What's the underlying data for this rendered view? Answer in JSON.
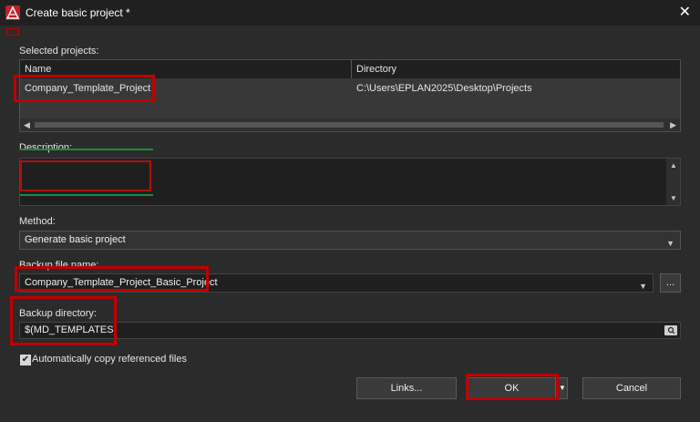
{
  "window": {
    "title": "Create basic project *",
    "close_glyph": "✕"
  },
  "selected_projects": {
    "label": "Selected projects:",
    "columns": [
      "Name",
      "Directory"
    ],
    "rows": [
      {
        "name": "Company_Template_Project",
        "directory": "C:\\Users\\EPLAN2025\\Desktop\\Projects"
      }
    ]
  },
  "description": {
    "label": "Description:",
    "value": ""
  },
  "method": {
    "label": "Method:",
    "value": "Generate basic project"
  },
  "backup_file_name": {
    "label": "Backup file name:",
    "value": "Company_Template_Project_Basic_Project",
    "browse_label": "..."
  },
  "backup_directory": {
    "label": "Backup directory:",
    "value": "$(MD_TEMPLATES)"
  },
  "auto_copy": {
    "label": "Automatically copy referenced files",
    "checked": true
  },
  "buttons": {
    "links": "Links...",
    "ok": "OK",
    "cancel": "Cancel"
  },
  "icons": {
    "app": "eplan-logo-icon",
    "browse": "folder-search-icon"
  },
  "colors": {
    "background": "#2b2b2b",
    "field": "#1f1f1f",
    "highlight": "#c00000",
    "accent": "#c0202a"
  }
}
